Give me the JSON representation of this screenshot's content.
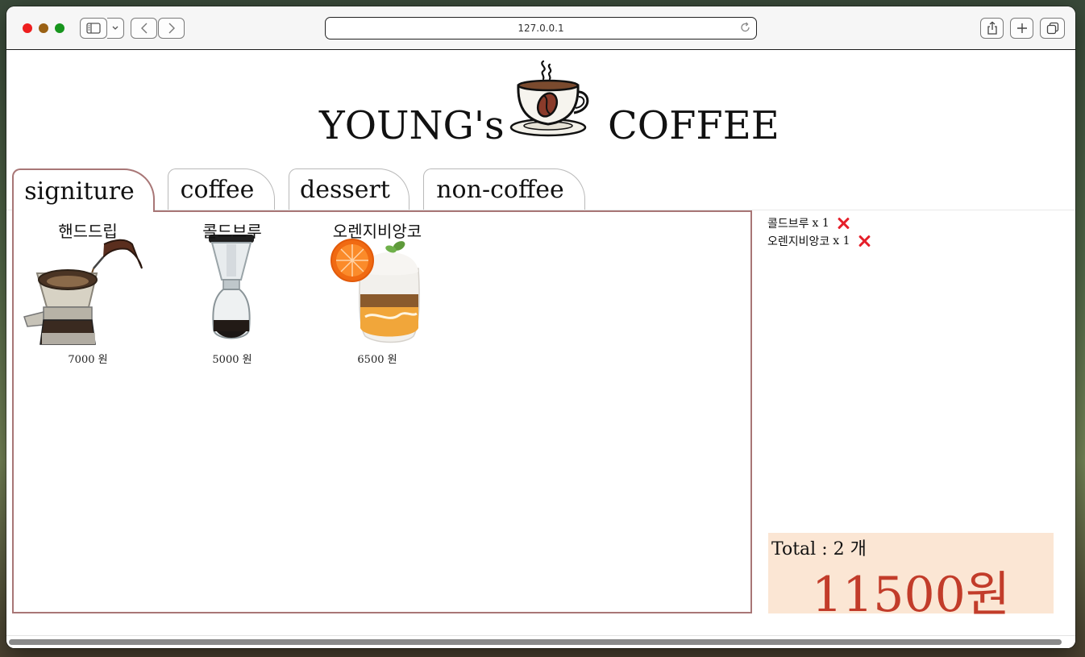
{
  "browser": {
    "address": "127.0.0.1"
  },
  "header": {
    "title_left": "YOUNG's",
    "title_right": "COFFEE",
    "logo_icon": "coffee-cup-icon"
  },
  "tabs": [
    {
      "label": "signiture",
      "active": true
    },
    {
      "label": "coffee",
      "active": false
    },
    {
      "label": "dessert",
      "active": false
    },
    {
      "label": "non-coffee",
      "active": false
    }
  ],
  "menu": {
    "items": [
      {
        "name": "핸드드립",
        "price": "7000 원",
        "icon": "hand-drip-icon"
      },
      {
        "name": "콜드브루",
        "price": "5000 원",
        "icon": "cold-brew-icon"
      },
      {
        "name": "오렌지비앙코",
        "price": "6500 원",
        "icon": "orange-bianco-icon"
      }
    ]
  },
  "cart": {
    "items": [
      {
        "name": "콜드브루",
        "qty": "x 1"
      },
      {
        "name": "오렌지비앙코",
        "qty": "x 1"
      }
    ],
    "total_label": "Total : 2 개",
    "total_price": "11500원"
  },
  "colors": {
    "tab_border": "#a87676",
    "total_bg": "#fbe6d4",
    "total_price": "#c23c2a",
    "remove": "#e5202b"
  }
}
